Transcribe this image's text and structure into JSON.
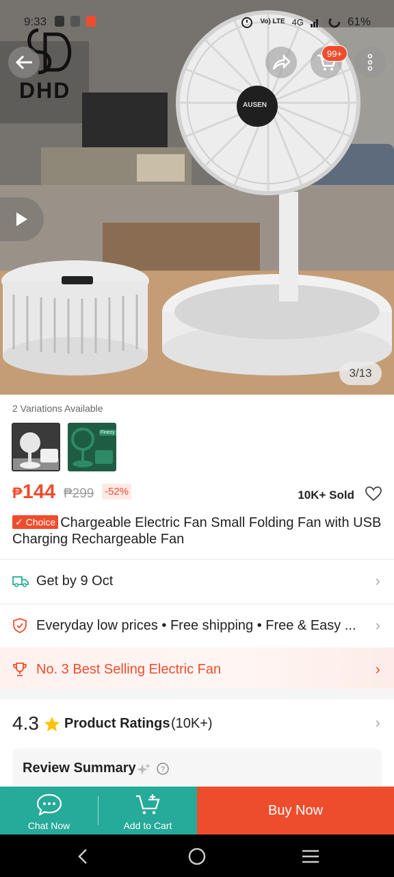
{
  "status_bar": {
    "time": "9:33",
    "network": "4G",
    "lte": "Vo) LTE",
    "battery": "61%"
  },
  "brand": {
    "logo_text": "DHD"
  },
  "header": {
    "cart_badge": "99+",
    "icons": [
      "back-arrow-icon",
      "share-icon",
      "cart-icon",
      "more-icon"
    ]
  },
  "gallery": {
    "counter": "3/13",
    "fan_logo": "AUSEN"
  },
  "product": {
    "variations_label": "2 Variations Available",
    "price_current": "144",
    "currency": "₱",
    "price_original": "₱299",
    "discount": "-52%",
    "sold": "10K+ Sold",
    "choice_badge": "✓ Choice",
    "title": "Chargeable Electric Fan Small Folding Fan with USB Charging Rechargeable Fan",
    "thumb2_tag": "Finezy"
  },
  "delivery": {
    "text": "Get by 9 Oct"
  },
  "guarantee": {
    "text": "Everyday low prices  •  Free shipping  •  Free & Easy ..."
  },
  "bestseller": {
    "text": "No. 3 Best Selling Electric Fan"
  },
  "ratings": {
    "score": "4.3",
    "label": "Product Ratings",
    "count": "(10K+)",
    "review_summary": "Review Summary"
  },
  "actions": {
    "chat": "Chat Now",
    "add_to_cart": "Add to Cart",
    "buy_now": "Buy Now"
  },
  "colors": {
    "accent": "#ee4d2d",
    "teal": "#26aa99"
  }
}
